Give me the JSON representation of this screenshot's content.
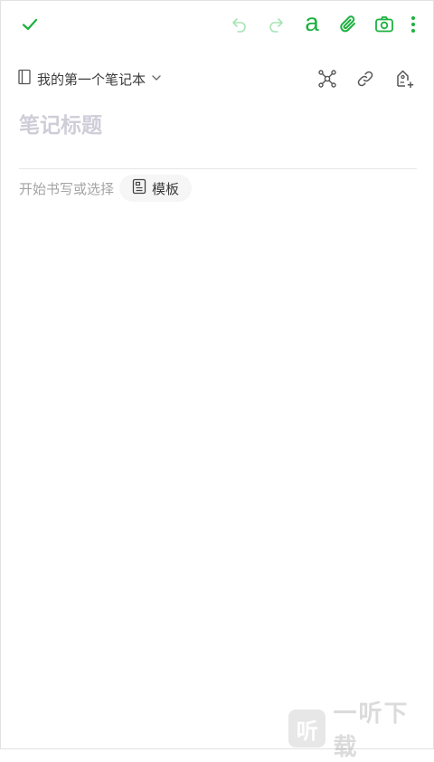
{
  "toolbar": {
    "done_icon": "check-icon",
    "undo_icon": "undo-icon",
    "redo_icon": "redo-icon",
    "format_icon": "text-format-icon",
    "format_glyph": "a",
    "attach_icon": "paperclip-icon",
    "camera_icon": "camera-icon",
    "more_icon": "more-vertical-icon"
  },
  "notebook": {
    "name": "我的第一个笔记本",
    "icon": "notebook-icon",
    "chevron": "chevron-down-icon"
  },
  "actions": {
    "mindmap_icon": "mindmap-icon",
    "link_icon": "link-icon",
    "tag_icon": "add-tag-icon"
  },
  "editor": {
    "title_placeholder": "笔记标题",
    "hint": "开始书写或选择",
    "template_label": "模板"
  },
  "watermark": {
    "logo_char": "听",
    "text": "一听下载"
  },
  "colors": {
    "accent": "#1db13f",
    "accent_light": "#a6e3b4",
    "icon_gray": "#555555",
    "placeholder": "#cfcdd8"
  }
}
